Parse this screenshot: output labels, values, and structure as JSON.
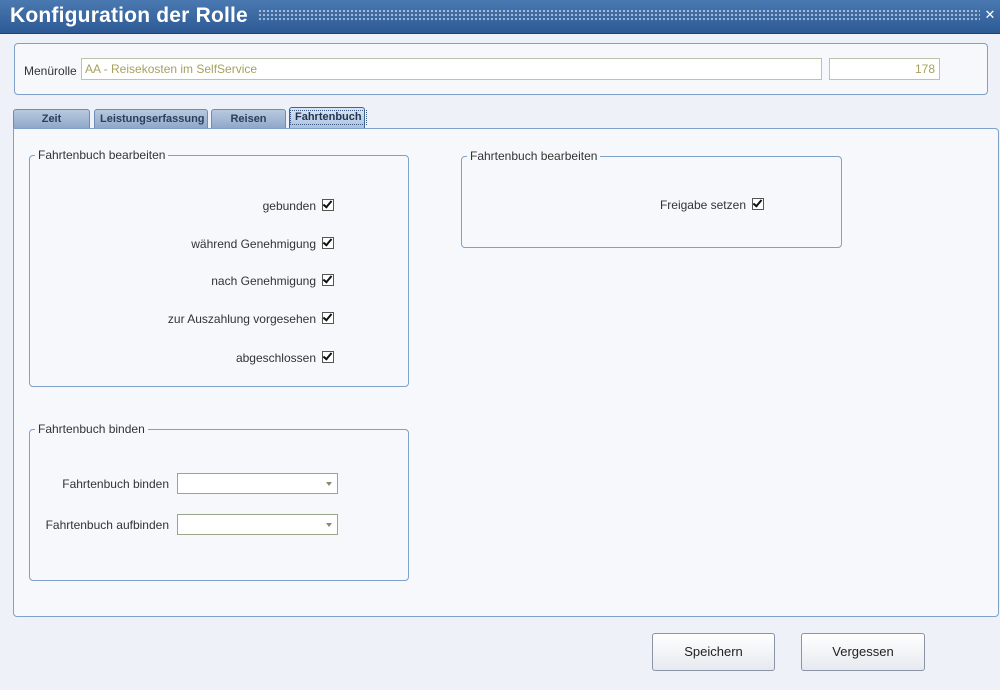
{
  "window": {
    "title": "Konfiguration der Rolle"
  },
  "role": {
    "label": "Menürolle",
    "name": "AA - Reisekosten im SelfService",
    "id": "178"
  },
  "tabs": [
    {
      "label": "Zeit",
      "active": false
    },
    {
      "label": "Leistungserfassung",
      "active": false
    },
    {
      "label": "Reisen",
      "active": false
    },
    {
      "label": "Fahrtenbuch",
      "active": true
    }
  ],
  "edit_group": {
    "title": "Fahrtenbuch bearbeiten",
    "checkboxes": [
      {
        "label": "gebunden",
        "checked": true
      },
      {
        "label": "während Genehmigung",
        "checked": true
      },
      {
        "label": "nach Genehmigung",
        "checked": true
      },
      {
        "label": "zur Auszahlung vorgesehen",
        "checked": true
      },
      {
        "label": "abgeschlossen",
        "checked": true
      }
    ]
  },
  "bind_group": {
    "title": "Fahrtenbuch binden",
    "fields": [
      {
        "label": "Fahrtenbuch binden",
        "value": ""
      },
      {
        "label": "Fahrtenbuch aufbinden",
        "value": ""
      }
    ]
  },
  "release_group": {
    "title": "Fahrtenbuch bearbeiten",
    "checkboxes": [
      {
        "label": "Freigabe setzen",
        "checked": true
      }
    ]
  },
  "buttons": {
    "save": "Speichern",
    "cancel": "Vergessen"
  }
}
